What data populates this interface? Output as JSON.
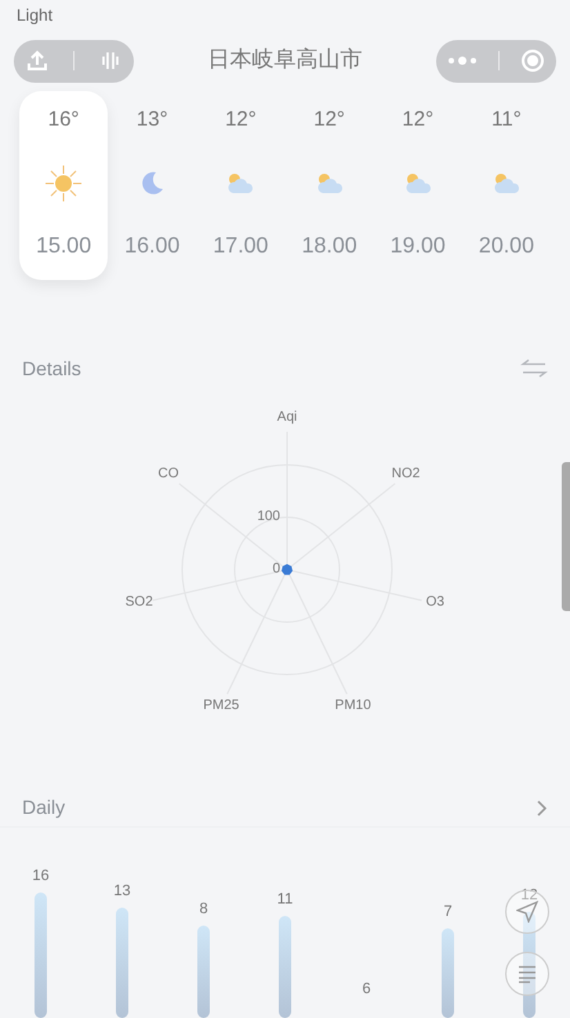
{
  "status_bar": {
    "label": "Light"
  },
  "header": {
    "title": "日本岐阜高山市"
  },
  "hourly": [
    {
      "temp": "16°",
      "kind": "sun",
      "time": "15.00",
      "selected": true
    },
    {
      "temp": "13°",
      "kind": "moon",
      "time": "16.00",
      "selected": false
    },
    {
      "temp": "12°",
      "kind": "cloud_sun",
      "time": "17.00",
      "selected": false
    },
    {
      "temp": "12°",
      "kind": "cloud_sun",
      "time": "18.00",
      "selected": false
    },
    {
      "temp": "12°",
      "kind": "cloud_sun",
      "time": "19.00",
      "selected": false
    },
    {
      "temp": "11°",
      "kind": "cloud_sun",
      "time": "20.00",
      "selected": false
    }
  ],
  "details": {
    "title": "Details",
    "radar": {
      "axes": [
        "Aqi",
        "NO2",
        "O3",
        "PM10",
        "PM25",
        "SO2",
        "CO"
      ],
      "ticks": [
        "100",
        "0"
      ]
    }
  },
  "daily": {
    "title": "Daily",
    "highs": [
      "16",
      "13",
      "8",
      "11",
      "6",
      "7",
      "12"
    ]
  }
}
